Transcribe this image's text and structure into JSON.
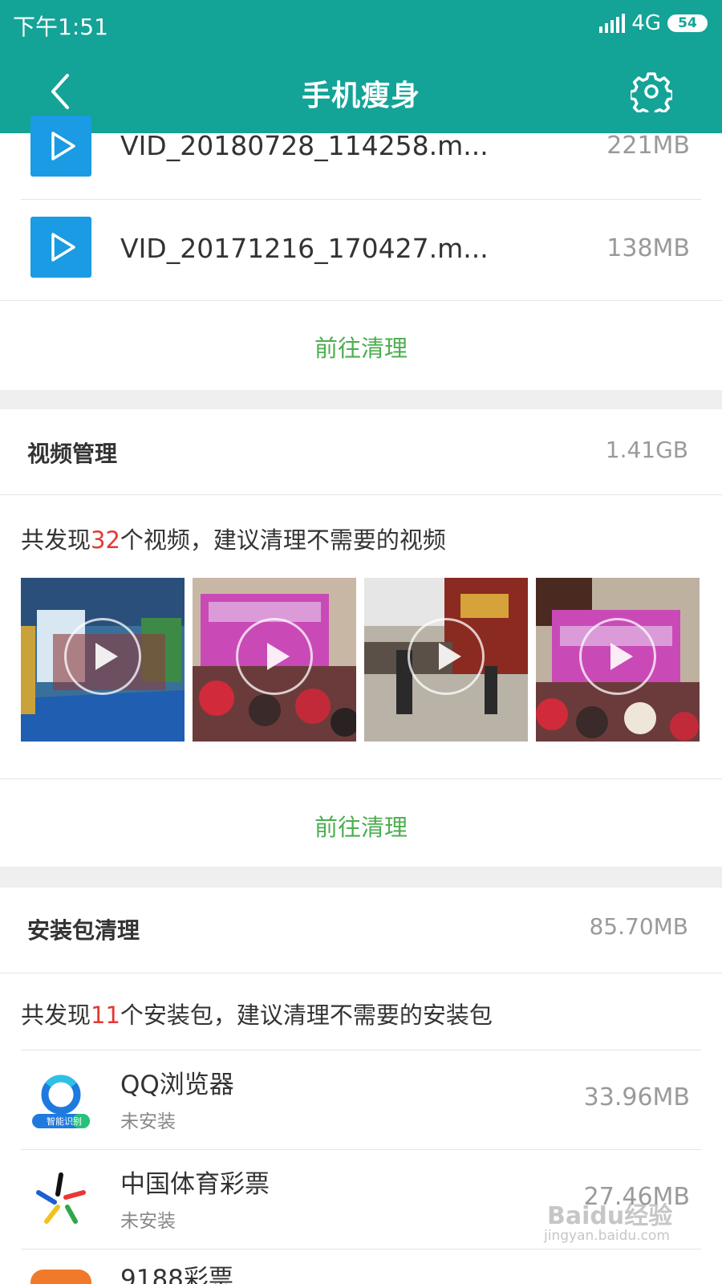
{
  "status": {
    "time": "下午1:51",
    "network": "4G",
    "battery": "54"
  },
  "header": {
    "title": "手机瘦身"
  },
  "files": [
    {
      "name": "VID_20180728_114258.m...",
      "size": "221MB"
    },
    {
      "name": "VID_20171216_170427.m...",
      "size": "138MB"
    }
  ],
  "clean_label": "前往清理",
  "video_section": {
    "title": "视频管理",
    "size": "1.41GB",
    "summary_prefix": "共发现",
    "summary_count": "32",
    "summary_suffix": "个视频，建议清理不需要的视频",
    "clean_label": "前往清理"
  },
  "package_section": {
    "title": "安装包清理",
    "size": "85.70MB",
    "summary_prefix": "共发现",
    "summary_count": "11",
    "summary_suffix": "个安装包，建议清理不需要的安装包",
    "apps": [
      {
        "name": "QQ浏览器",
        "status": "未安装",
        "size": "33.96MB",
        "badge": "智能识别"
      },
      {
        "name": "中国体育彩票",
        "status": "未安装",
        "size": "27.46MB"
      },
      {
        "name": "9188彩票"
      }
    ]
  },
  "watermark": {
    "text": "Baidu经验",
    "sub": "jingyan.baidu.com"
  },
  "colors": {
    "primary": "#14a397",
    "accent_green": "#4caf50",
    "count_red": "#e53935",
    "play_blue": "#1a9be3"
  }
}
